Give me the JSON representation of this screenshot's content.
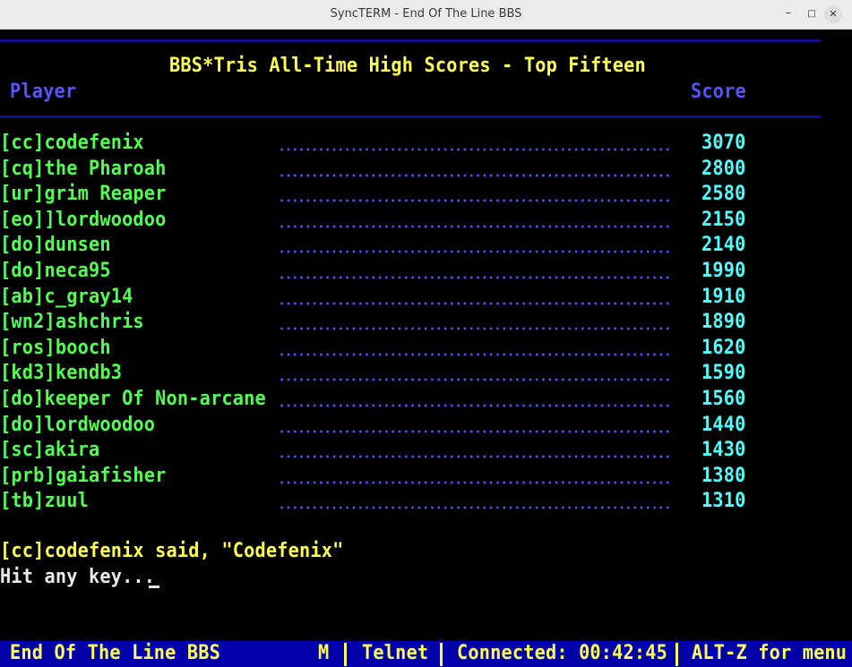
{
  "window": {
    "title": "SyncTERM - End Of The Line BBS",
    "minimize": "–",
    "maximize": "□",
    "close": "✕"
  },
  "header": {
    "title": "BBS*Tris All-Time High Scores - Top Fifteen",
    "col_player": "Player",
    "col_score": "Score"
  },
  "scores": [
    {
      "player": "[cc]codefenix",
      "score": "3070"
    },
    {
      "player": "[cq]the Pharoah",
      "score": "2800"
    },
    {
      "player": "[ur]grim Reaper",
      "score": "2580"
    },
    {
      "player": "[eo]]lordwoodoo",
      "score": "2150"
    },
    {
      "player": "[do]dunsen",
      "score": "2140"
    },
    {
      "player": "[do]neca95",
      "score": "1990"
    },
    {
      "player": "[ab]c_gray14",
      "score": "1910"
    },
    {
      "player": "[wn2]ashchris",
      "score": "1890"
    },
    {
      "player": "[ros]booch",
      "score": "1620"
    },
    {
      "player": "[kd3]kendb3",
      "score": "1590"
    },
    {
      "player": "[do]keeper Of Non-arcane",
      "score": "1560"
    },
    {
      "player": "[do]lordwoodoo",
      "score": "1440"
    },
    {
      "player": "[sc]akira",
      "score": "1430"
    },
    {
      "player": "[prb]gaiafisher",
      "score": "1380"
    },
    {
      "player": "[tb]zuul",
      "score": "1310"
    }
  ],
  "message": {
    "said": "[cc]codefenix said, \"Codefenix\"",
    "prompt": "Hit any key..."
  },
  "status": {
    "bbs": "End Of The Line BBS",
    "mode": "M",
    "protocol": "Telnet",
    "connected": "Connected: 00:42:45",
    "help": "ALT-Z for menu"
  },
  "colors": {
    "yellow": "#ffff55",
    "blue": "#5555ff",
    "green": "#55ff55",
    "cyan": "#55ffff",
    "status_bg": "#0000aa"
  }
}
